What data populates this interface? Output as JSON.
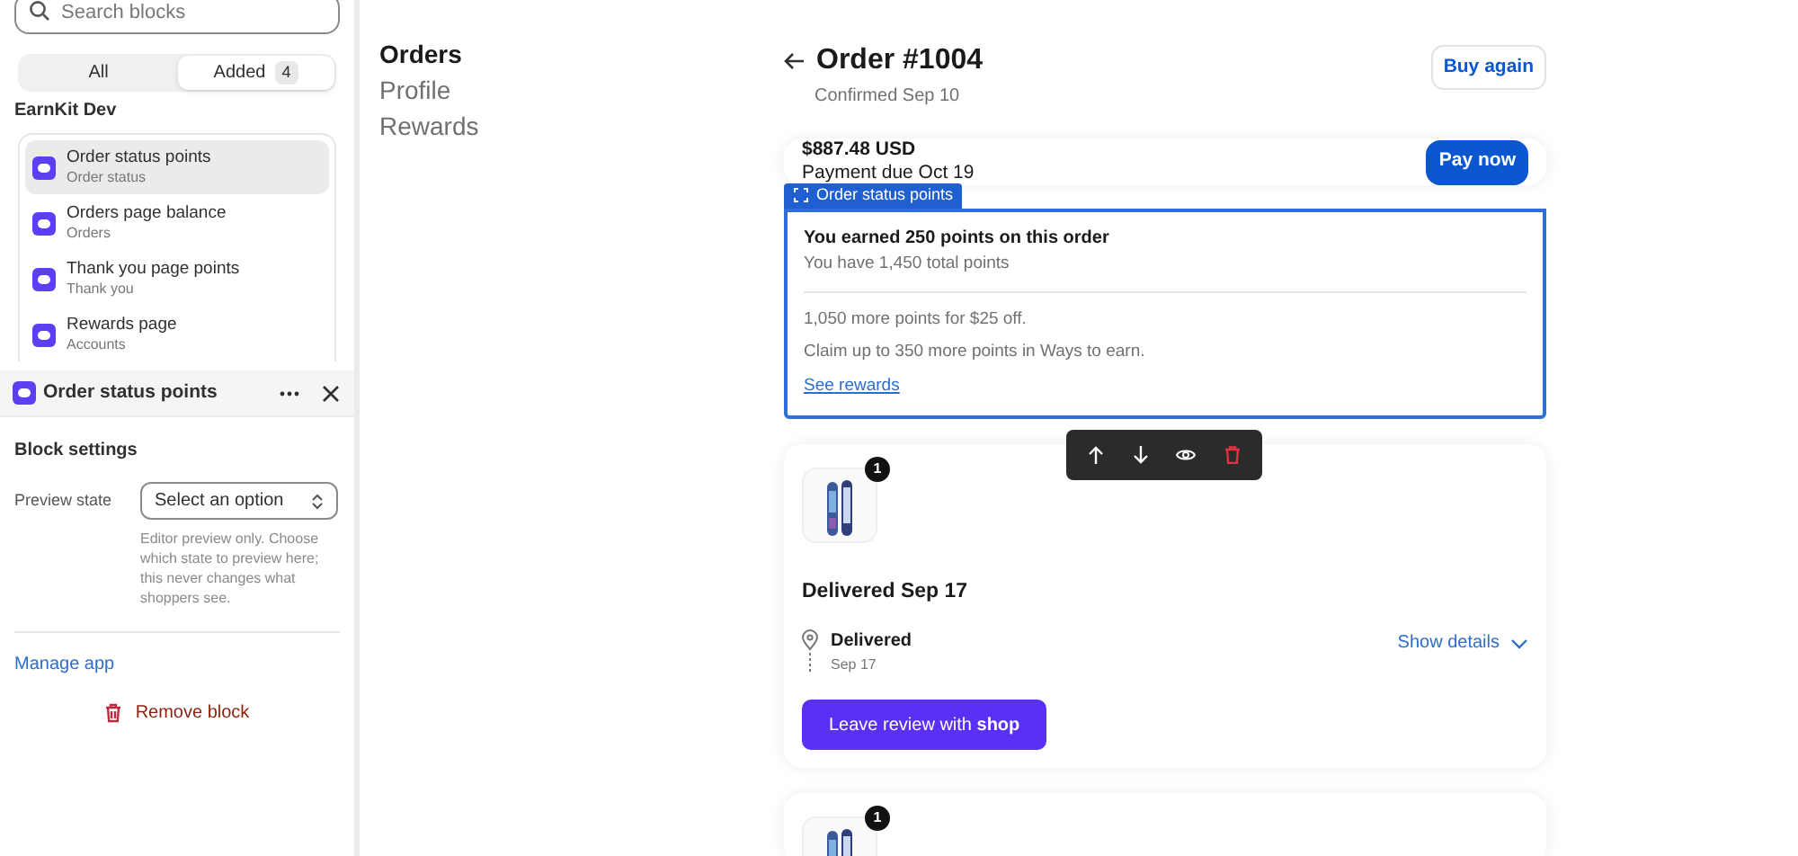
{
  "sidebar": {
    "search": {
      "placeholder": "Search blocks"
    },
    "tabs": [
      {
        "label": "All",
        "selected": false
      },
      {
        "label": "Added",
        "count": "4",
        "selected": true
      }
    ],
    "group_title": "EarnKit Dev",
    "blocks": [
      {
        "title": "Order status points",
        "subtitle": "Order status",
        "selected": true
      },
      {
        "title": "Orders page balance",
        "subtitle": "Orders",
        "selected": false
      },
      {
        "title": "Thank you page points",
        "subtitle": "Thank you",
        "selected": false
      },
      {
        "title": "Rewards page",
        "subtitle": "Accounts",
        "selected": false
      }
    ],
    "block_panel": {
      "title": "Order status points",
      "settings_title": "Block settings",
      "field_label": "Preview state",
      "select_value": "Select an option",
      "help": "Editor preview only. Choose which state to preview here; this never changes what shoppers see.",
      "manage_link": "Manage app",
      "remove_label": "Remove block"
    }
  },
  "nav": [
    {
      "label": "Orders",
      "selected": true
    },
    {
      "label": "Profile",
      "selected": false
    },
    {
      "label": "Rewards",
      "selected": false
    }
  ],
  "order": {
    "title": "Order #1004",
    "subtitle": "Confirmed Sep 10",
    "buy_again": "Buy again",
    "payment": {
      "amount": "$887.48 USD",
      "due": "Payment due Oct 19",
      "button": "Pay now"
    },
    "block": {
      "tag": "Order status points",
      "headline": "You earned 250 points on this order",
      "total": "You have 1,450 total points",
      "lines": [
        "1,050 more points for $25 off.",
        "Claim up to 350 more points in Ways to earn."
      ],
      "link": "See rewards"
    },
    "fulfillments": [
      {
        "badge": "1",
        "kind": "picture",
        "title": "Delivered Sep 17",
        "status": "Delivered",
        "date": "Sep 17",
        "details": "Show details",
        "button": "Leave review with **shop**"
      },
      {
        "badge": "1",
        "kind": "picture"
      }
    ]
  }
}
